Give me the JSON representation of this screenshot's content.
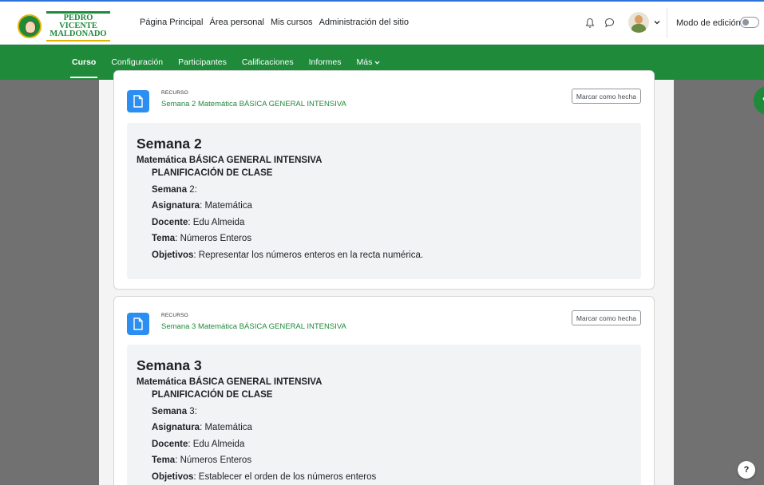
{
  "brand": {
    "name_line1": "PEDRO VICENTE",
    "name_line2": "MALDONADO"
  },
  "primary_nav": [
    "Página Principal",
    "Área personal",
    "Mis cursos",
    "Administración del sitio"
  ],
  "user_tools": {
    "edit_mode_label": "Modo de edición",
    "edit_mode_on": false,
    "icons": [
      "bell-icon",
      "chat-icon",
      "avatar",
      "chevron-down-icon"
    ]
  },
  "secondary_nav": {
    "items": [
      "Curso",
      "Configuración",
      "Participantes",
      "Calificaciones",
      "Informes",
      "Más"
    ],
    "active": "Curso"
  },
  "activities": [
    {
      "type": "RECURSO",
      "title": "Semana 2 Matemática BÁSICA GENERAL INTENSIVA",
      "button": "Marcar como hecha",
      "heading": "Semana 2",
      "subject_line": "Matemática BÁSICA GENERAL INTENSIVA",
      "plan_title": "PLANIFICACIÓN DE CLASE",
      "fields": [
        {
          "label": "Semana",
          "value": " 2:"
        },
        {
          "label": "Asignatura",
          "value": ": Matemática"
        },
        {
          "label": "Docente",
          "value": ": Edu Almeida"
        },
        {
          "label": "Tema",
          "value": ": Números Enteros"
        },
        {
          "label": "Objetivos",
          "value": ": Representar los números enteros en la recta numérica."
        }
      ]
    },
    {
      "type": "RECURSO",
      "title": "Semana 3 Matemática BÁSICA GENERAL INTENSIVA",
      "button": "Marcar como hecha",
      "heading": "Semana 3",
      "subject_line": "Matemática BÁSICA GENERAL INTENSIVA",
      "plan_title": "PLANIFICACIÓN DE CLASE",
      "fields": [
        {
          "label": "Semana",
          "value": " 3:"
        },
        {
          "label": "Asignatura",
          "value": ": Matemática"
        },
        {
          "label": "Docente",
          "value": ": Edu Almeida"
        },
        {
          "label": "Tema",
          "value": ": Números Enteros"
        },
        {
          "label": "Objetivos",
          "value": ": Establecer el orden de los números enteros"
        }
      ]
    }
  ],
  "help_button": "?",
  "drawer_toggle": "‹",
  "colors": {
    "brand_green": "#1e8a3a",
    "resource_blue": "#2b8ef0",
    "accent_gold": "#e0b300"
  }
}
